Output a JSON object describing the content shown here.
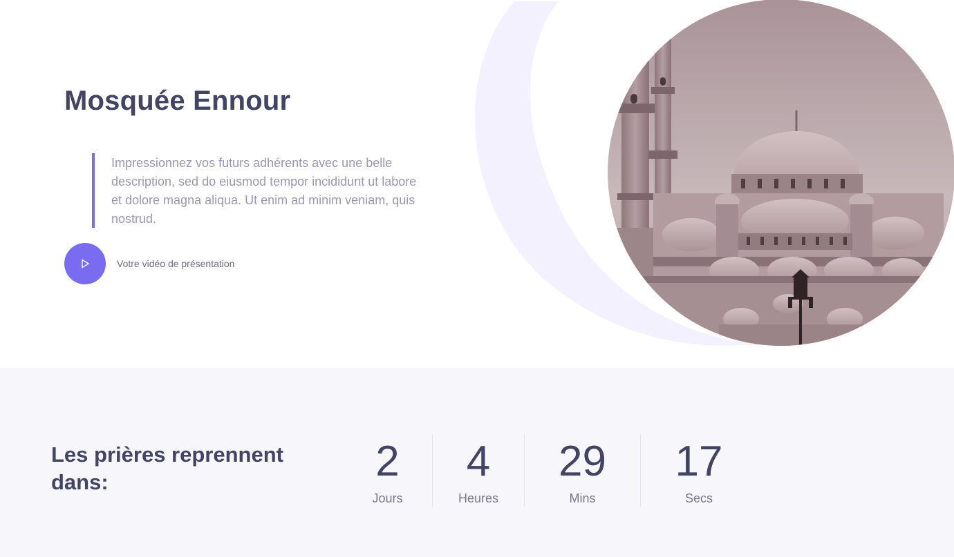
{
  "hero": {
    "title": "Mosquée Ennour",
    "description": "Impressionnez vos futurs adhérents avec une belle description, sed do eiusmod tempor incididunt ut labore et dolore magna aliqua. Ut enim ad minim veniam, quis nostrud.",
    "video_label": "Votre vidéo de présentation",
    "play_icon": "play-icon",
    "image_subject": "mosque-photo"
  },
  "countdown": {
    "heading": "Les prières reprennent dans:",
    "units": [
      {
        "value": "2",
        "label": "Jours"
      },
      {
        "value": "4",
        "label": "Heures"
      },
      {
        "value": "29",
        "label": "Mins"
      },
      {
        "value": "17",
        "label": "Secs"
      }
    ]
  },
  "colors": {
    "accent": "#7a6cf0",
    "heading": "#434363",
    "muted": "#9a98ae",
    "band_background": "#f6f6fb",
    "crescent": "#f2f1fd"
  }
}
